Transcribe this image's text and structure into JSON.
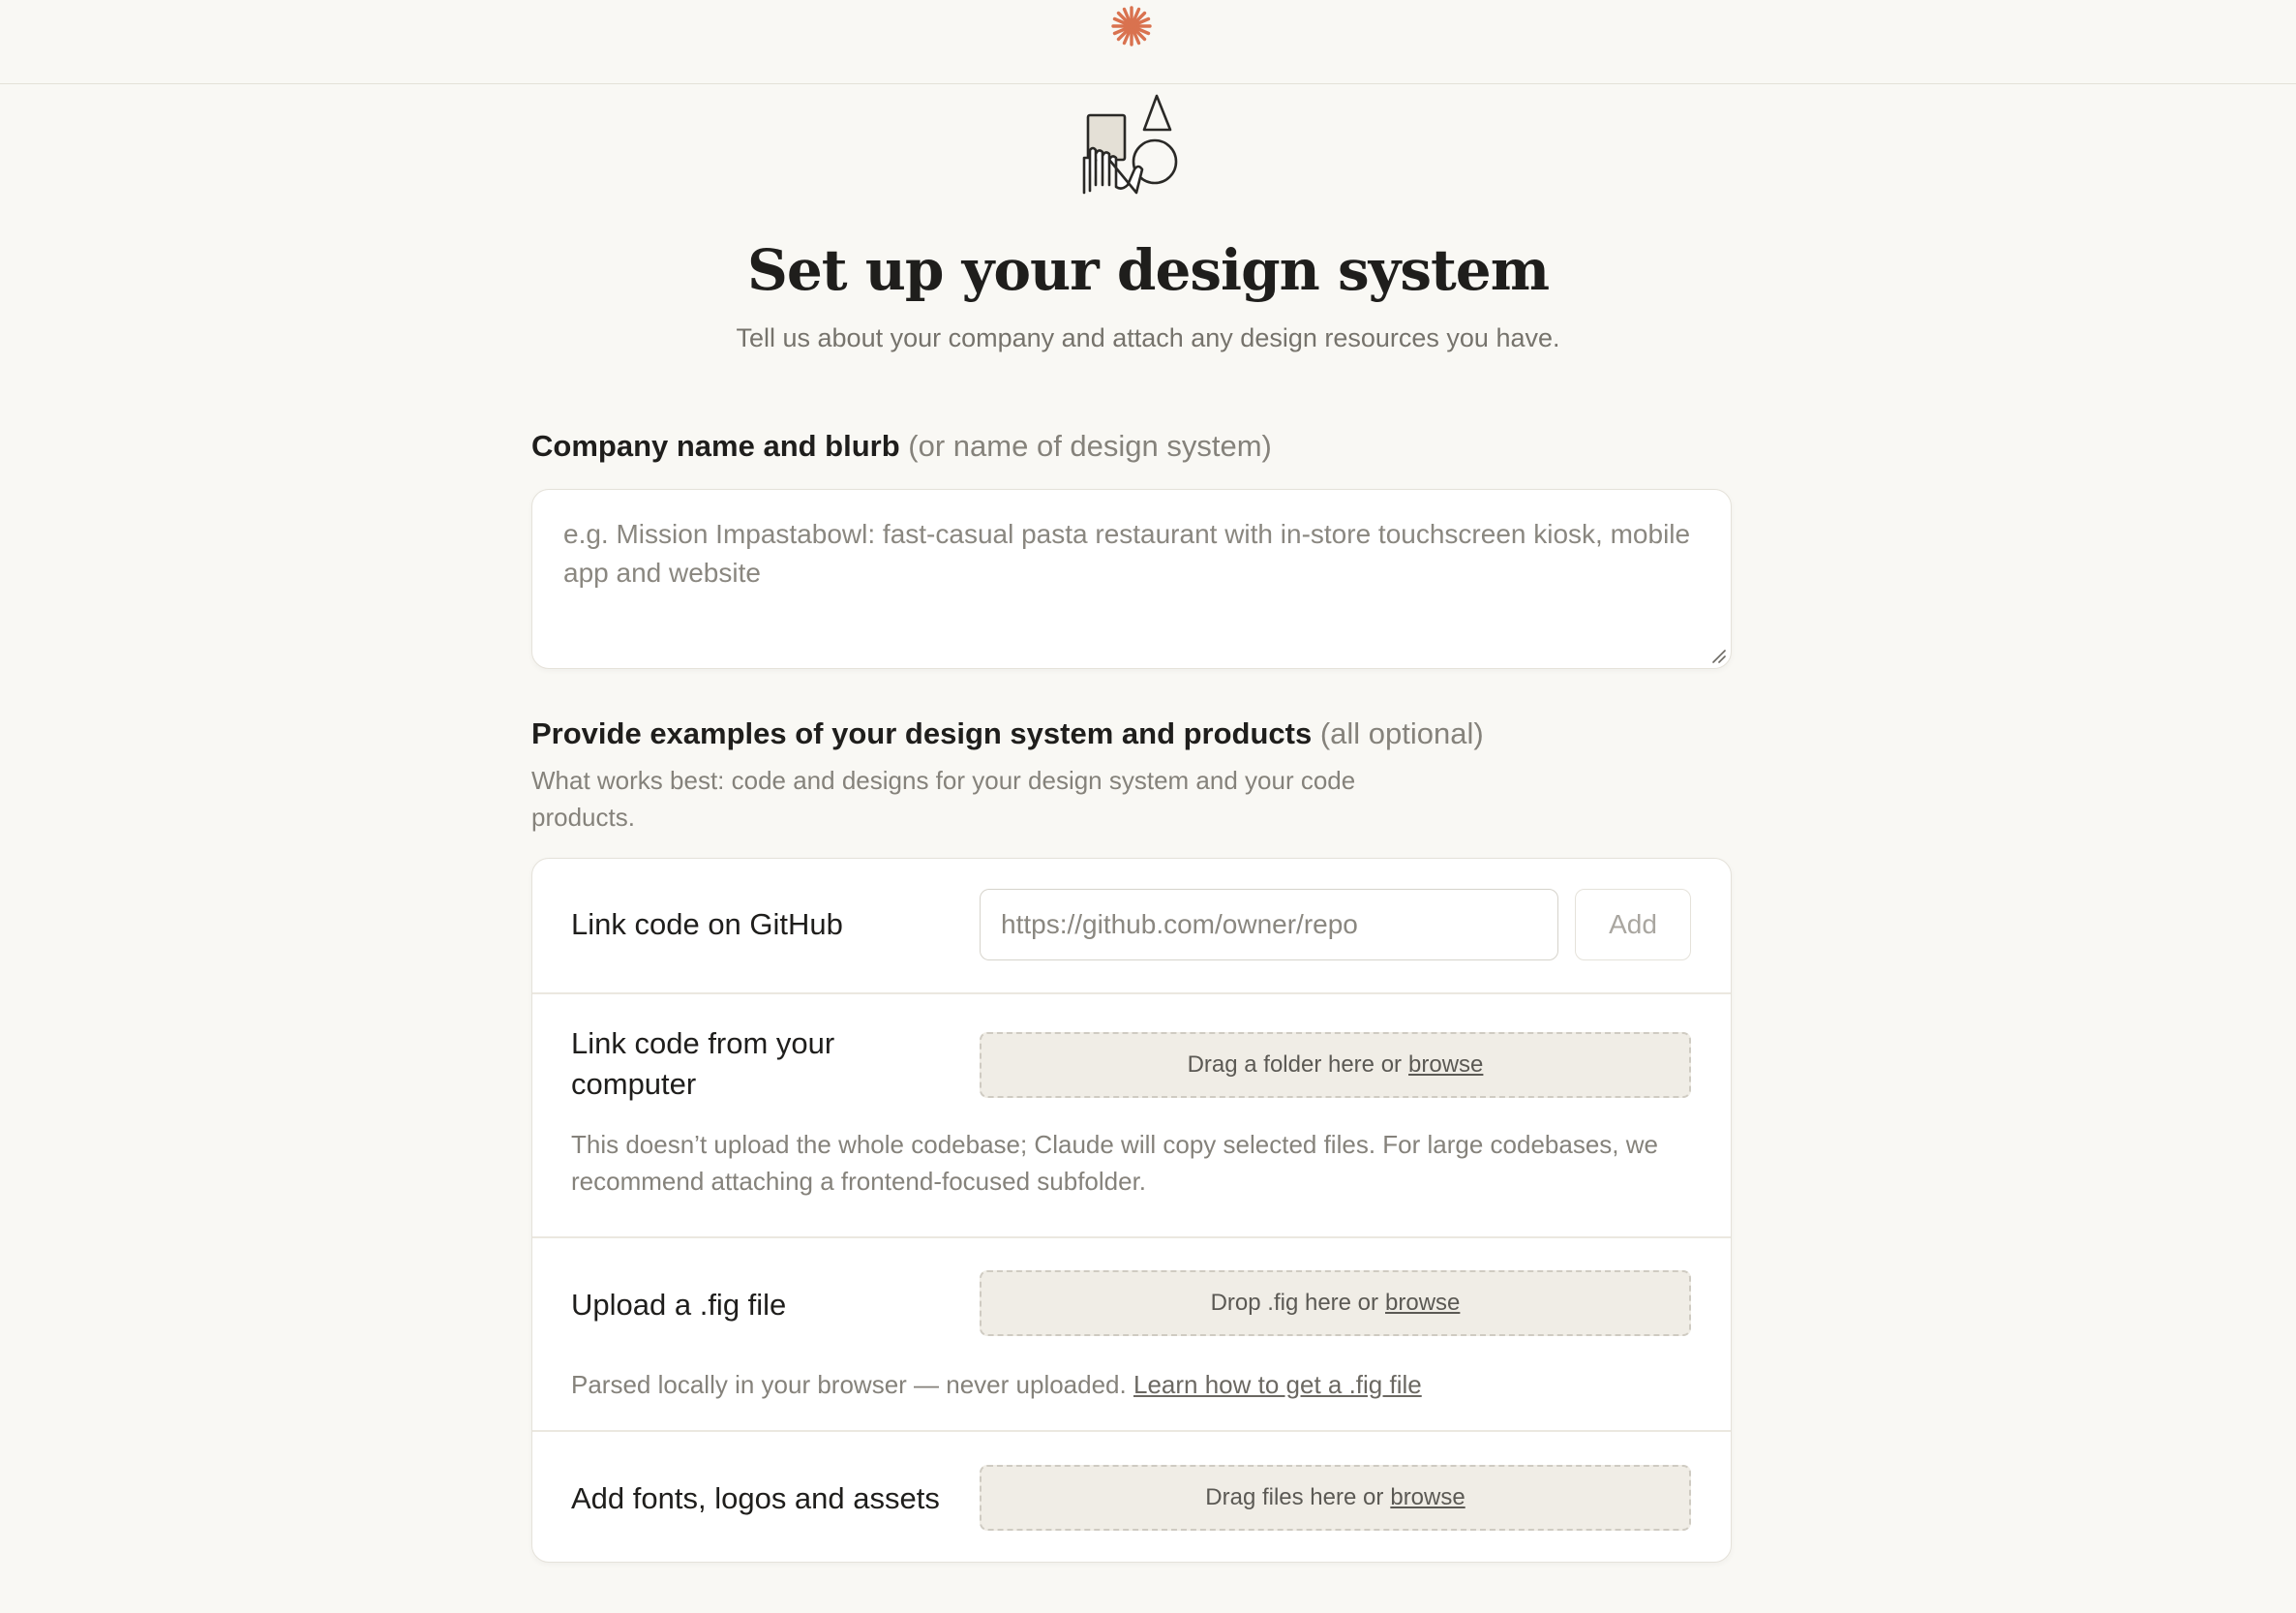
{
  "header": {
    "logo_icon": "asterisk-burst-icon",
    "accent_color": "#d9724f"
  },
  "hero": {
    "icon": "hand-holding-shapes-icon",
    "title": "Set up your design system",
    "subtitle": "Tell us about your company and attach any design resources you have."
  },
  "company": {
    "label": "Company name and blurb",
    "label_hint": "(or name of design system)",
    "placeholder": "e.g. Mission Impastabowl: fast-casual pasta restaurant with in-store touchscreen kiosk, mobile app and website"
  },
  "examples": {
    "label": "Provide examples of your design system and products",
    "label_hint": "(all optional)",
    "help": "What works best: code and designs for your design system and your code products."
  },
  "github": {
    "label": "Link code on GitHub",
    "placeholder": "https://github.com/owner/repo",
    "add_label": "Add"
  },
  "local_code": {
    "label": "Link code from your computer",
    "drop_text": "Drag a folder here or",
    "browse": "browse",
    "note": "This doesn’t upload the whole codebase; Claude will copy selected files. For large codebases, we recommend attaching a frontend-focused subfolder."
  },
  "fig": {
    "label": "Upload a .fig file",
    "drop_text": "Drop .fig here or",
    "browse": "browse",
    "note": "Parsed locally in your browser — never uploaded.",
    "note_link": "Learn how to get a .fig file"
  },
  "assets": {
    "label": "Add fonts, logos and assets",
    "drop_text": "Drag files here or",
    "browse": "browse"
  }
}
